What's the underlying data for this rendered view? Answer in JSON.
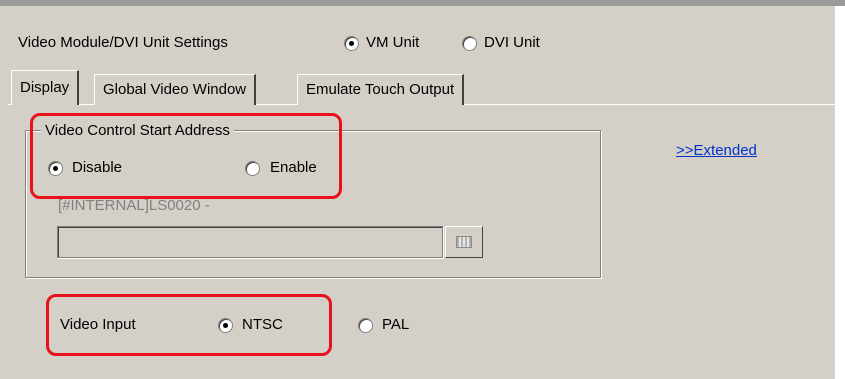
{
  "settings": {
    "title": "Video Module/DVI Unit Settings",
    "options": [
      {
        "label": "VM Unit",
        "selected": true
      },
      {
        "label": "DVI Unit",
        "selected": false
      }
    ]
  },
  "tabs": [
    {
      "label": "Display",
      "active": true
    },
    {
      "label": "Global Video Window",
      "active": false
    },
    {
      "label": "Emulate Touch Output",
      "active": false
    }
  ],
  "video_control": {
    "legend": "Video Control Start Address",
    "options": [
      {
        "label": "Disable",
        "selected": true
      },
      {
        "label": "Enable",
        "selected": false
      }
    ],
    "address_label": "[#INTERNAL]LS0020 -",
    "address_value": ""
  },
  "extended_link": ">>Extended",
  "video_input": {
    "label": "Video Input",
    "options": [
      {
        "label": "NTSC",
        "selected": true
      },
      {
        "label": "PAL",
        "selected": false
      }
    ]
  },
  "colors": {
    "highlight": "#e8101a",
    "link": "#0033cc",
    "panel": "#d4d0c8"
  }
}
